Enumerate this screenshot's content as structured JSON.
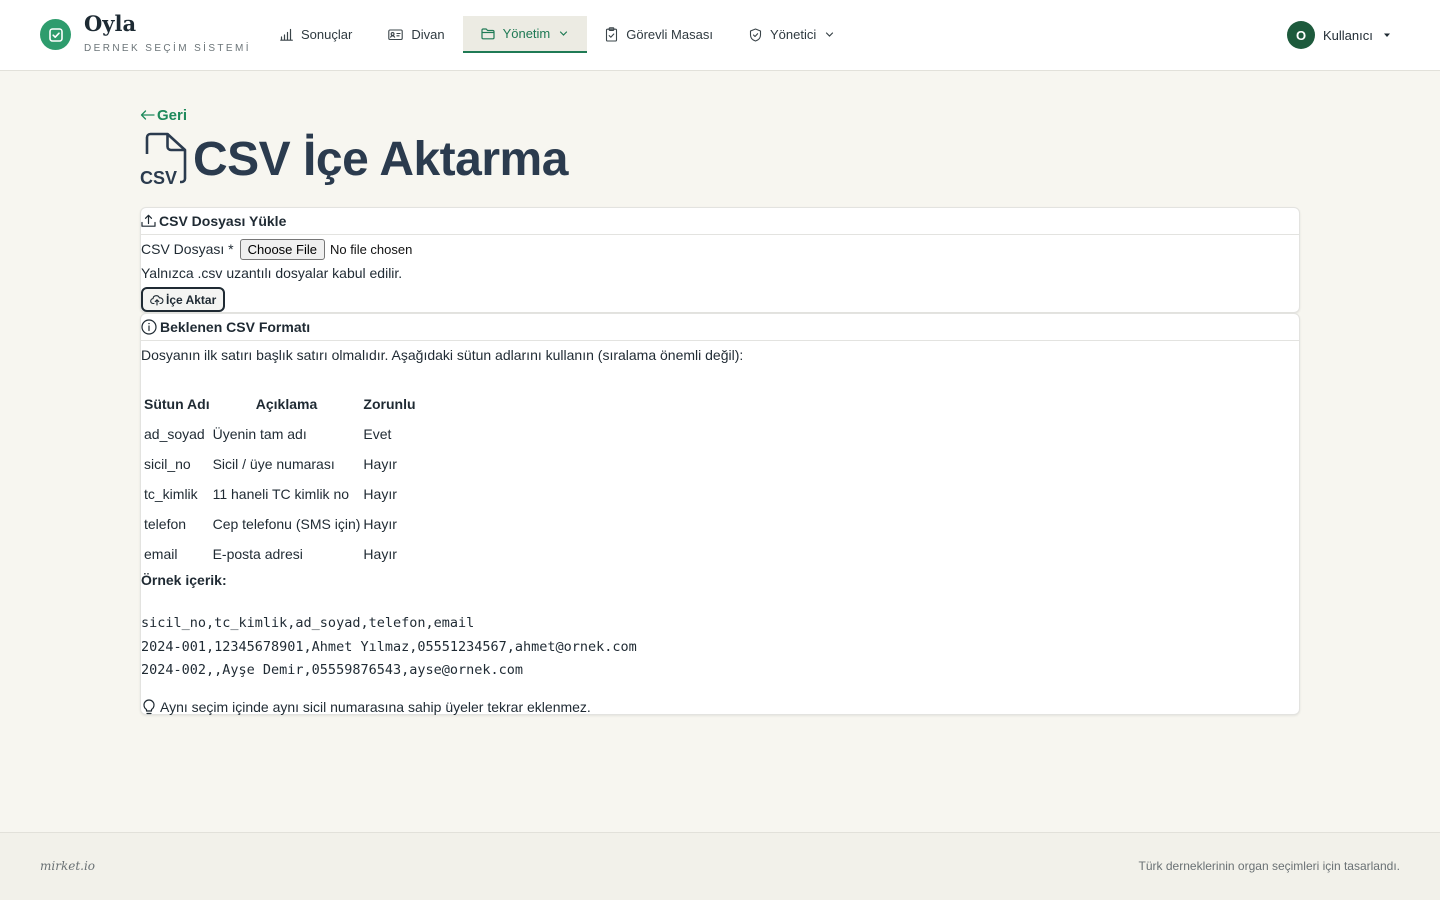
{
  "brand": {
    "name": "Oyla",
    "subtitle": "DERNEK SEÇİM SİSTEMİ",
    "icon": "check-square-icon"
  },
  "nav": {
    "results": "Sonuçlar",
    "board": "Divan",
    "management": "Yönetim",
    "duty_desk": "Görevli Masası",
    "admin": "Yönetici"
  },
  "user": {
    "initial": "O",
    "name": "Kullanıcı"
  },
  "page": {
    "back": "Geri",
    "title": "CSV İçe Aktarma",
    "title_icon_label": "CSV"
  },
  "upload_card": {
    "heading": "CSV Dosyası Yükle",
    "file_label": "CSV Dosyası *",
    "file_button": "Choose File",
    "file_status": "No file chosen",
    "hint": "Yalnızca .csv uzantılı dosyalar kabul edilir.",
    "import_button": "İçe Aktar"
  },
  "format_card": {
    "heading": "Beklenen CSV Formatı",
    "intro": "Dosyanın ilk satırı başlık satırı olmalıdır. Aşağıdaki sütun adlarını kullanın (sıralama önemli değil):",
    "columns": [
      "Sütun Adı",
      "Açıklama",
      "Zorunlu"
    ],
    "rows": [
      [
        "ad_soyad",
        "Üyenin tam adı",
        "Evet"
      ],
      [
        "sicil_no",
        "Sicil / üye numarası",
        "Hayır"
      ],
      [
        "tc_kimlik",
        "11 haneli TC kimlik no",
        "Hayır"
      ],
      [
        "telefon",
        "Cep telefonu (SMS için)",
        "Hayır"
      ],
      [
        "email",
        "E-posta adresi",
        "Hayır"
      ]
    ],
    "sample_label": "Örnek içerik:",
    "sample_lines": [
      "sicil_no,tc_kimlik,ad_soyad,telefon,email",
      "2024-001,12345678901,Ahmet Yılmaz,05551234567,ahmet@ornek.com",
      "2024-002,,Ayşe Demir,05559876543,ayse@ornek.com"
    ],
    "tip": "Aynı seçim içinde aynı sicil numarasına sahip üyeler tekrar eklenmez."
  },
  "footer": {
    "left": "mirket.io",
    "right": "Türk derneklerinin organ seçimleri için tasarlandı."
  },
  "colors": {
    "accent": "#1f8a5c",
    "brand_green": "#2e9c6d",
    "title": "#2b3b4e",
    "avatar": "#1d5a3c"
  }
}
